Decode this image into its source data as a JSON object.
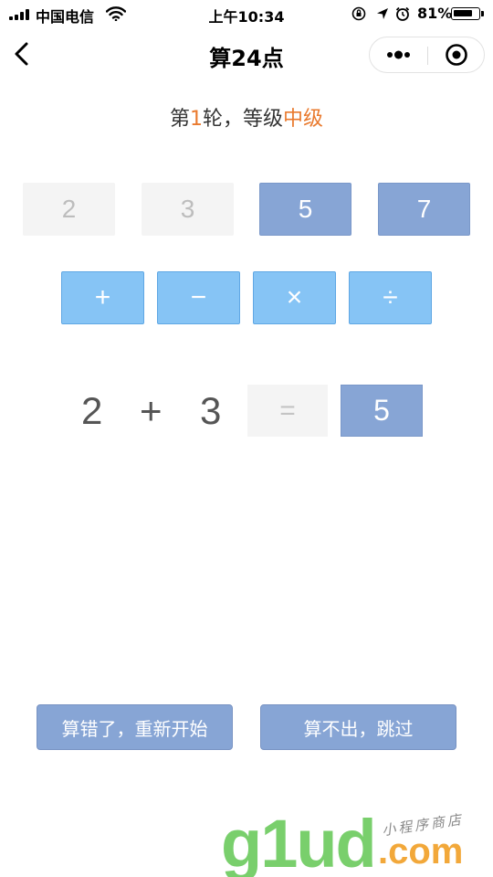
{
  "status_bar": {
    "carrier": "中国电信",
    "time": "上午10:34",
    "battery_percent": "81%",
    "battery_level": 0.81,
    "icons": [
      "signal-icon",
      "wifi-icon",
      "orientation-lock-icon",
      "location-icon",
      "alarm-icon",
      "battery-icon"
    ]
  },
  "nav": {
    "title": "算24点",
    "back_icon": "chevron-left-icon",
    "more_icon": "more-dots-icon",
    "close_icon": "target-close-icon"
  },
  "round": {
    "prefix": "第",
    "number": "1",
    "middle": "轮，等级",
    "level": "中级",
    "accent_color": "#e97a2e"
  },
  "numbers": [
    {
      "value": "2",
      "state": "used"
    },
    {
      "value": "3",
      "state": "used"
    },
    {
      "value": "5",
      "state": "active"
    },
    {
      "value": "7",
      "state": "active"
    }
  ],
  "operators": [
    "+",
    "−",
    "×",
    "÷"
  ],
  "expression": {
    "left": "2",
    "operator": "+",
    "right": "3",
    "equals": "=",
    "result": "5"
  },
  "actions": {
    "restart": "算错了，重新开始",
    "skip": "算不出，跳过"
  },
  "watermark": {
    "brand": "g1ud",
    "domain": ".com",
    "tagline": "小程序商店"
  },
  "colors": {
    "number_active": "#87a5d5",
    "number_used": "#f4f4f4",
    "operator": "#86c4f5",
    "action_button": "#87a5d5"
  }
}
